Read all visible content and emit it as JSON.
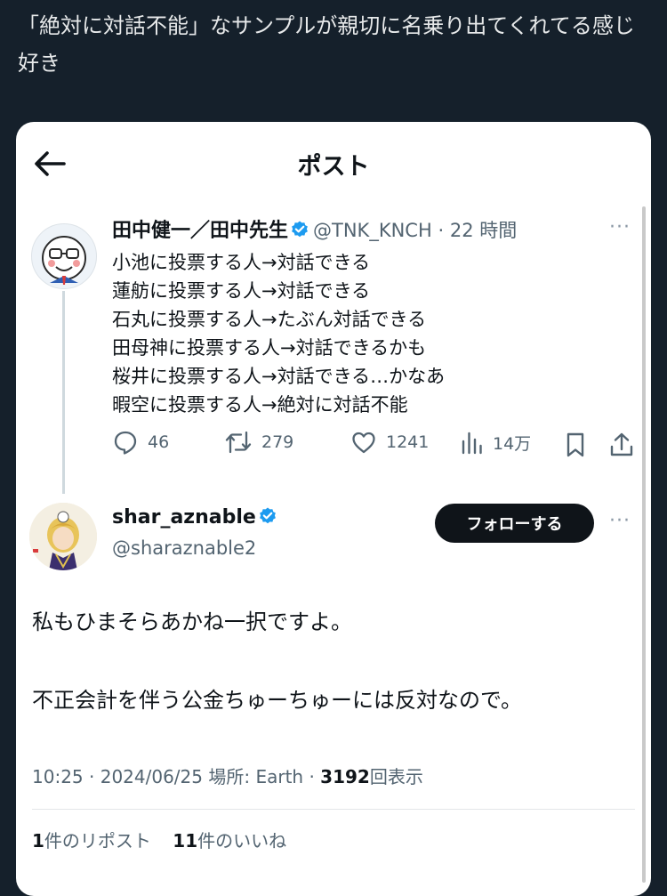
{
  "caption": "「絶対に対話不能」なサンプルが親切に名乗り出てくれてる感じ好き",
  "header": {
    "title": "ポスト",
    "back_icon": "arrow-left-icon"
  },
  "quoted_post": {
    "display_name": "田中健一／田中先生",
    "handle": "@TNK_KNCH",
    "time_sep": "·",
    "time": "22 時間",
    "more": "···",
    "lines": [
      "小池に投票する人→対話できる",
      "蓮舫に投票する人→対話できる",
      "石丸に投票する人→たぶん対話できる",
      "田母神に投票する人→対話できるかも",
      "桜井に投票する人→対話できる…かなあ",
      "暇空に投票する人→絶対に対話不能"
    ],
    "actions": {
      "replies": "46",
      "reposts": "279",
      "likes": "1241",
      "views": "14万"
    }
  },
  "reply_post": {
    "display_name": "shar_aznable",
    "handle": "@sharaznable2",
    "follow_label": "フォローする",
    "more": "···",
    "body_line1": "私もひまそらあかね一択ですよ。",
    "body_line2": "不正会計を伴う公金ちゅーちゅーには反対なので。",
    "meta": {
      "time": "10:25",
      "sep": "·",
      "date": "2024/06/25",
      "location": "場所: Earth",
      "views_count": "3192",
      "views_label": "回表示"
    },
    "stats": {
      "reposts_count": "1",
      "reposts_label": "件のリポスト",
      "likes_count": "11",
      "likes_label": "件のいいね"
    }
  },
  "colors": {
    "background": "#15202b",
    "card": "#ffffff",
    "verified": "#1d9bf0",
    "muted": "#536471",
    "follow_button": "#0f1419"
  }
}
